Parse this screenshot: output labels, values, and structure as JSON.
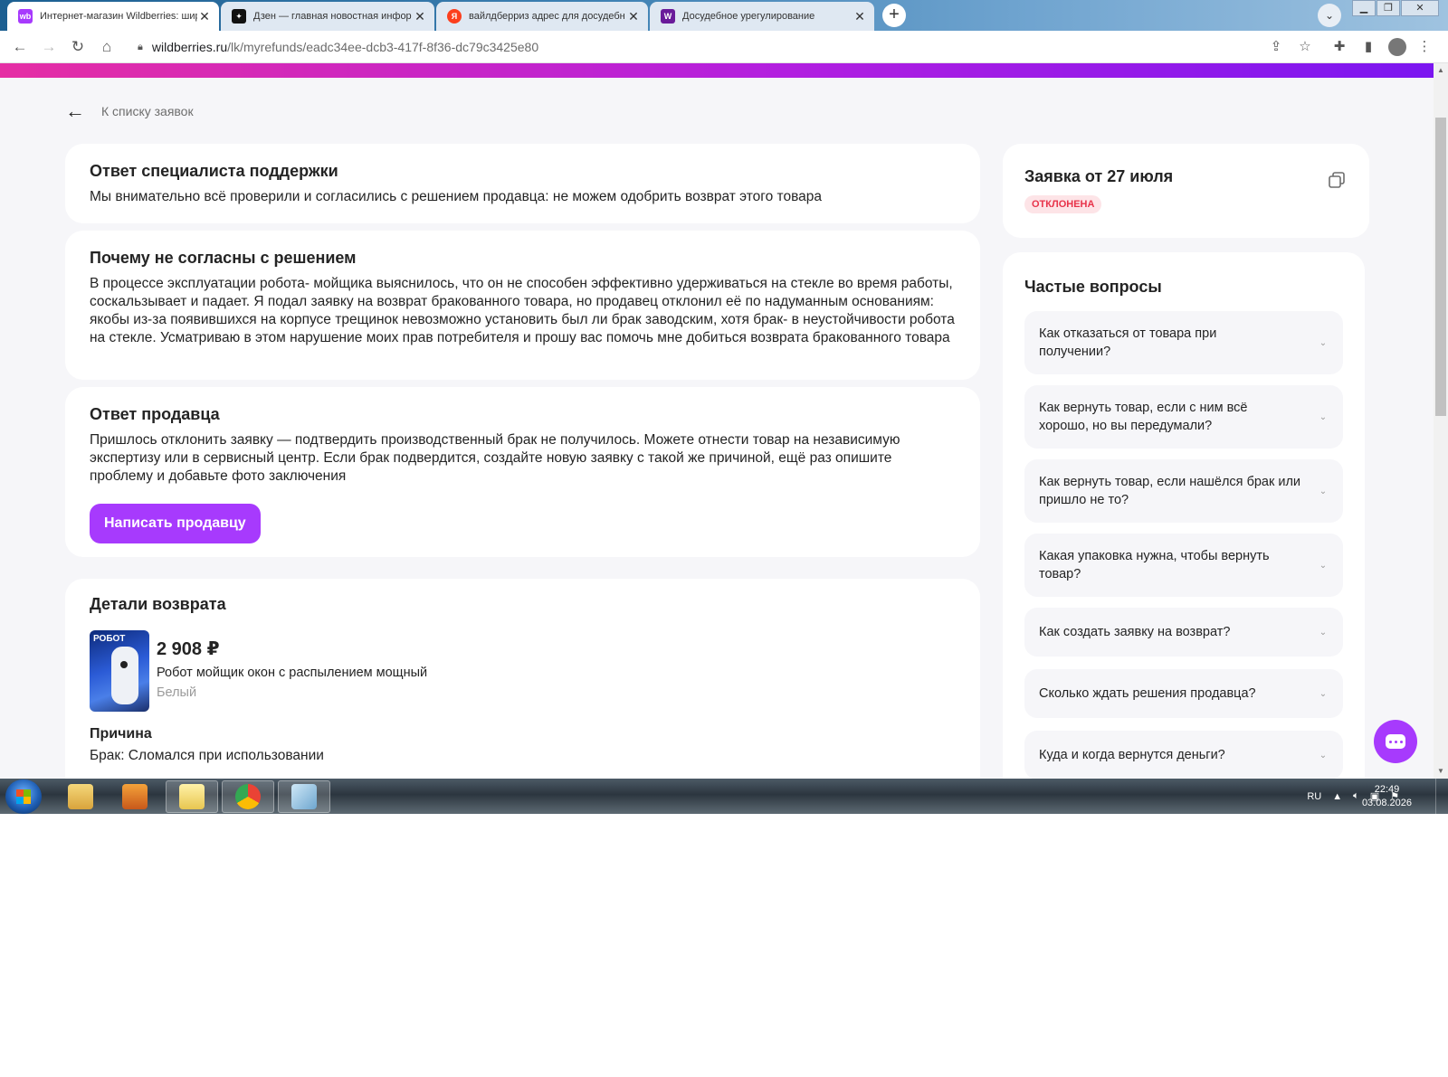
{
  "browser": {
    "tabs": [
      {
        "title": "Интернет-магазин Wildberries: шир",
        "favicon_color": "#a73afd",
        "favicon_text": "wb",
        "active": true
      },
      {
        "title": "Дзен — главная новостная инфор",
        "favicon_color": "#111111",
        "favicon_text": "✦",
        "active": false
      },
      {
        "title": "вайлдберриз адрес для досудебн",
        "favicon_color": "#fc3f1d",
        "favicon_text": "Я",
        "active": false
      },
      {
        "title": "Досудебное урегулирование",
        "favicon_color": "#6a1b9a",
        "favicon_text": "W",
        "active": false
      }
    ],
    "new_tab": "+",
    "url_host": "wildberries.ru",
    "url_path": "/lk/myrefunds/eadc34ee-dcb3-417f-8f36-dc79c3425e80"
  },
  "page": {
    "back_label": "К списку заявок",
    "support": {
      "title": "Ответ специалиста поддержки",
      "text": "Мы внимательно всё проверили и согласились с решением продавца: не можем одобрить возврат этого товара"
    },
    "disagree": {
      "title": "Почему не согласны с решением",
      "text": "В процессе эксплуатации робота- мойщика выяснилось, что он не способен эффективно удерживаться на стекле во время работы, соскальзывает и падает. Я подал заявку на возврат бракованного товара, но продавец отклонил её по надуманным основаниям: якобы из-за появившихся на корпусе трещинок невозможно установить был ли брак заводским, хотя брак- в неустойчивости робота на стекле. Усматриваю в этом нарушение моих прав потребителя и прошу вас помочь мне добиться возврата бракованного товара"
    },
    "seller": {
      "title": "Ответ продавца",
      "text": "Пришлось отклонить заявку — подтвердить производственный брак не получилось. Можете отнести товар на независимую экспертизу или в сервисный центр. Если брак подвердится, создайте новую заявку с такой же причиной, ещё раз опишите проблему и добавьте фото заключения",
      "button": "Написать продавцу"
    },
    "details": {
      "title": "Детали возврата",
      "image_tag": "РОБОТ",
      "price": "2 908 ₽",
      "product_name": "Робот мойщик окон с распылением мощный",
      "product_color": "Белый",
      "reason_label": "Причина",
      "reason_value": "Брак: Сломался при использовании"
    },
    "request": {
      "title": "Заявка от 27 июля",
      "status": "ОТКЛОНЕНА"
    },
    "faq": {
      "title": "Частые вопросы",
      "items": [
        "Как отказаться от товара при получении?",
        "Как вернуть товар, если с ним всё хорошо, но вы передумали?",
        "Как вернуть товар, если нашёлся брак или пришло не то?",
        "Какая упаковка нужна, чтобы вернуть товар?",
        "Как создать заявку на возврат?",
        "Сколько ждать решения продавца?",
        "Куда и когда вернутся деньги?"
      ]
    }
  },
  "taskbar": {
    "language": "RU",
    "time": "22:49",
    "date": "03.08.2026"
  }
}
